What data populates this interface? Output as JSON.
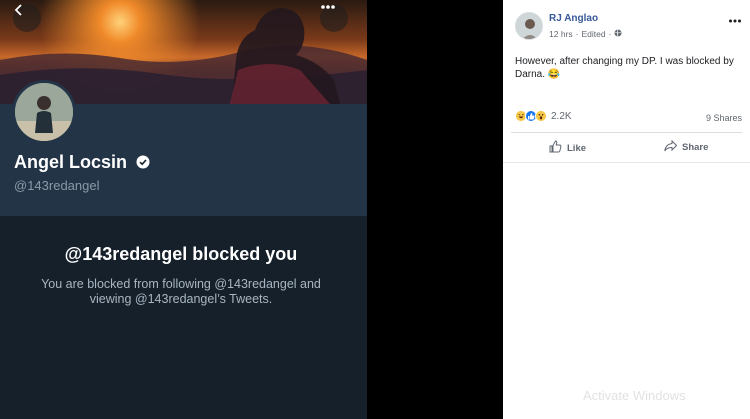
{
  "twitter": {
    "profile_name": "Angel Locsin",
    "handle": "@143redangel",
    "blocked_title": "@143redangel blocked you",
    "blocked_description": "You are blocked from following @143redangel and viewing @143redangel’s Tweets.",
    "icons": {
      "back": "back-arrow-icon",
      "more": "more-options-icon",
      "verified": "verified-badge-icon"
    },
    "colors": {
      "background": "#15202b",
      "header": "#243447",
      "secondary_text": "#8899a6"
    }
  },
  "facebook_post": {
    "author": "RJ Anglao",
    "time": "12 hrs",
    "edited": "Edited",
    "text": "However, after changing my DP. I was blocked by Darna. 😂",
    "reaction_count": "2.2K",
    "shares": "9 Shares",
    "like_label": "Like",
    "share_label": "Share",
    "icons": {
      "privacy": "globe-icon",
      "more": "ellipsis-icon",
      "like": "thumbs-up-icon",
      "share": "share-arrow-icon",
      "reactions": [
        "haha-reaction-icon",
        "like-reaction-icon",
        "wow-reaction-icon"
      ]
    },
    "colors": {
      "author": "#385898",
      "meta": "#616770"
    }
  },
  "watermark": "Activate Windows"
}
